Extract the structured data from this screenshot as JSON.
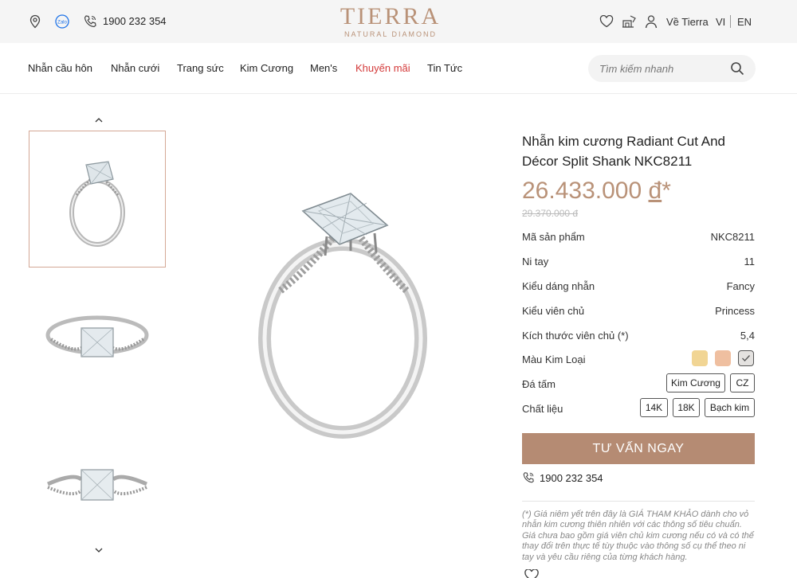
{
  "topbar": {
    "icons": [
      "location-icon",
      "zalo-icon",
      "phone-icon"
    ],
    "zalo_label": "Zalo",
    "phone": "1900 232 354",
    "logo": {
      "brand": "TIERRA",
      "tagline": "NATURAL DIAMOND"
    },
    "right_icons": [
      "heart-icon",
      "store-icon",
      "user-icon"
    ],
    "about_label": "Về Tierra",
    "lang_vi": "VI",
    "lang_en": "EN"
  },
  "nav": {
    "items": [
      {
        "label": "Nhẫn cầu hôn"
      },
      {
        "label": "Nhẫn cưới"
      },
      {
        "label": "Trang sức"
      },
      {
        "label": "Kim Cương"
      },
      {
        "label": "Men's"
      },
      {
        "label": "Khuyến mãi"
      },
      {
        "label": "Tin Tức"
      }
    ],
    "promo_color": "#d43a3a",
    "search": {
      "placeholder": "Tìm kiếm nhanh"
    }
  },
  "gallery": {
    "active_index": 0,
    "thumb_count": 3,
    "accent": "#d4a896"
  },
  "product": {
    "title_line1": "Nhẫn kim cương Radiant Cut And",
    "title_line2": "Décor Split Shank NKC8211",
    "price_value": "26.433.000",
    "price_currency": "đ",
    "price_mark": "*",
    "old_price": "29.370.000 đ",
    "price_color": "#b99278",
    "specs": [
      {
        "key": "Mã sản phẩm",
        "value": "NKC8211"
      },
      {
        "key": "Ni tay",
        "value": "11"
      },
      {
        "key": "Kiểu dáng nhẫn",
        "value": "Fancy"
      },
      {
        "key": "Kiểu viên chủ",
        "value": "Princess"
      },
      {
        "key": "Kích thước viên chủ (*)",
        "value": "5,4"
      }
    ],
    "metal_label": "Màu Kim Loại",
    "metal_colors": [
      "#f1d594",
      "#efbfa0",
      "#e4e2e0"
    ],
    "metal_selected": 2,
    "stone_label": "Đá tấm",
    "stone_options": [
      "Kim Cương",
      "CZ"
    ],
    "material_label": "Chất liệu",
    "material_options": [
      "14K",
      "18K",
      "Bạch kim"
    ],
    "cta_label": "TƯ VẤN NGAY",
    "cta_color": "#b58b73",
    "hotline": "1900 232 354",
    "disclaimer": "(*) Giá niêm yết trên đây là GIÁ THAM KHẢO dành cho vỏ nhẫn kim cương thiên nhiên với các thông số tiêu chuẩn. Giá chưa bao gồm giá viên chủ kim cương nếu có và có thể thay đổi trên thực tế tùy thuộc vào thông số cụ thể theo ni tay và yêu cầu riêng của từng khách hàng."
  }
}
